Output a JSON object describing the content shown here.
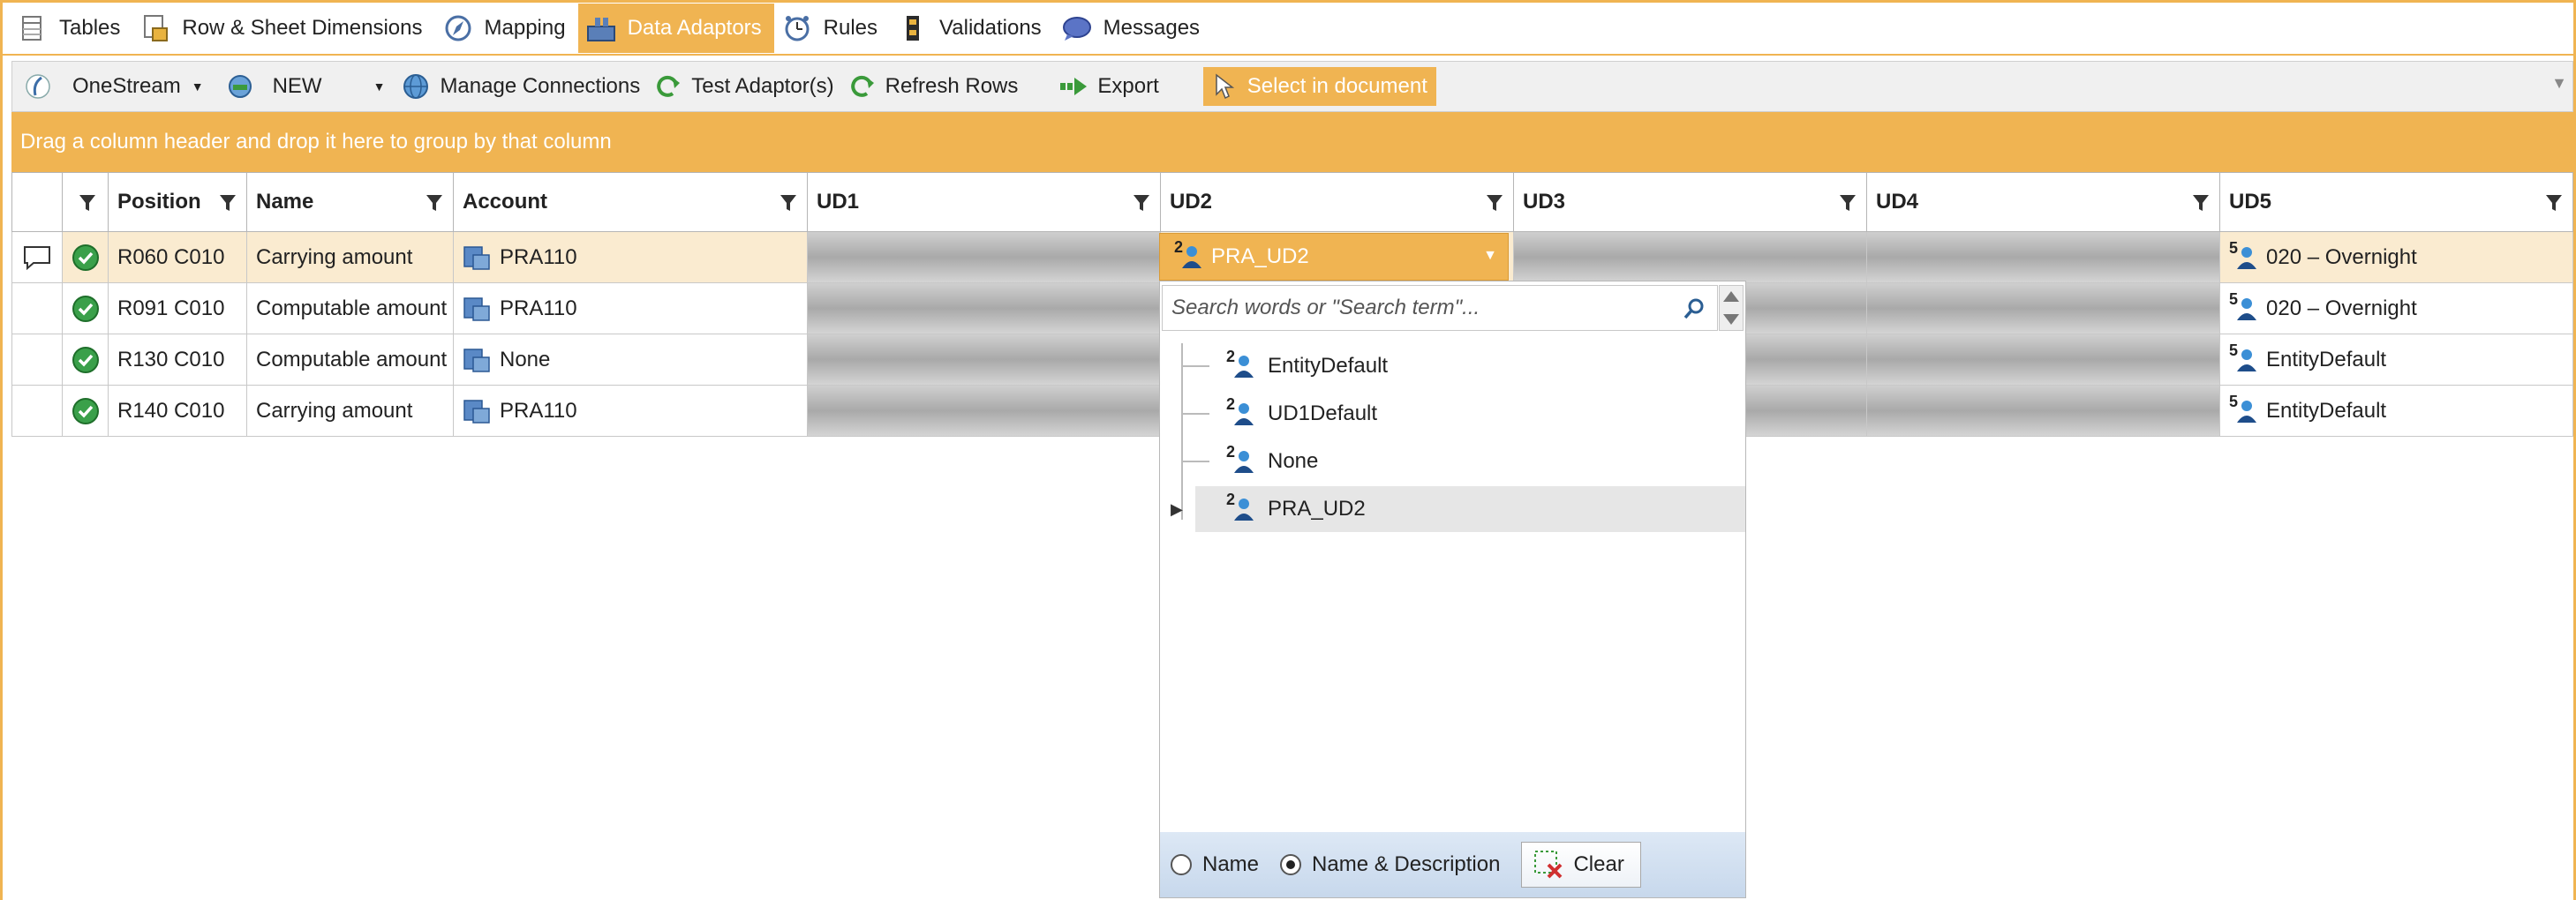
{
  "tabs": [
    {
      "label": "Tables",
      "icon": "table-icon",
      "active": false
    },
    {
      "label": "Row & Sheet Dimensions",
      "icon": "dimensions-icon",
      "active": false
    },
    {
      "label": "Mapping",
      "icon": "compass-icon",
      "active": false
    },
    {
      "label": "Data Adaptors",
      "icon": "adaptor-icon",
      "active": true
    },
    {
      "label": "Rules",
      "icon": "clock-icon",
      "active": false
    },
    {
      "label": "Validations",
      "icon": "validation-icon",
      "active": false
    },
    {
      "label": "Messages",
      "icon": "message-icon",
      "active": false
    }
  ],
  "toolbar": {
    "onestream": "OneStream",
    "new": "NEW",
    "manage": "Manage Connections",
    "test": "Test Adaptor(s)",
    "refresh": "Refresh Rows",
    "export": "Export",
    "select": "Select in document"
  },
  "group_hint": "Drag a column header and drop it here to group by that column",
  "columns": [
    "Position",
    "Name",
    "Account",
    "UD1",
    "UD2",
    "UD3",
    "UD4",
    "UD5"
  ],
  "rows": [
    {
      "position": "R060 C010",
      "name": "Carrying amount",
      "account": "PRA110",
      "ud5_num": "5",
      "ud5": "020 – Overnight"
    },
    {
      "position": "R091 C010",
      "name": "Computable amount",
      "account": "PRA110",
      "ud5_num": "5",
      "ud5": "020 – Overnight"
    },
    {
      "position": "R130 C010",
      "name": "Computable amount",
      "account": "None",
      "ud5_num": "5",
      "ud5": "EntityDefault"
    },
    {
      "position": "R140 C010",
      "name": "Carrying amount",
      "account": "PRA110",
      "ud5_num": "5",
      "ud5": "EntityDefault"
    }
  ],
  "ud2_picker": {
    "num": "2",
    "value": "PRA_UD2",
    "search_placeholder": "Search words or \"Search term\"...",
    "items": [
      {
        "num": "2",
        "label": "EntityDefault"
      },
      {
        "num": "2",
        "label": "UD1Default"
      },
      {
        "num": "2",
        "label": "None"
      },
      {
        "num": "2",
        "label": "PRA_UD2"
      }
    ],
    "radio_name": "Name",
    "radio_name_desc": "Name & Description",
    "clear": "Clear"
  },
  "colors": {
    "accent": "#f0b452",
    "row_highlight": "#faebd0"
  }
}
